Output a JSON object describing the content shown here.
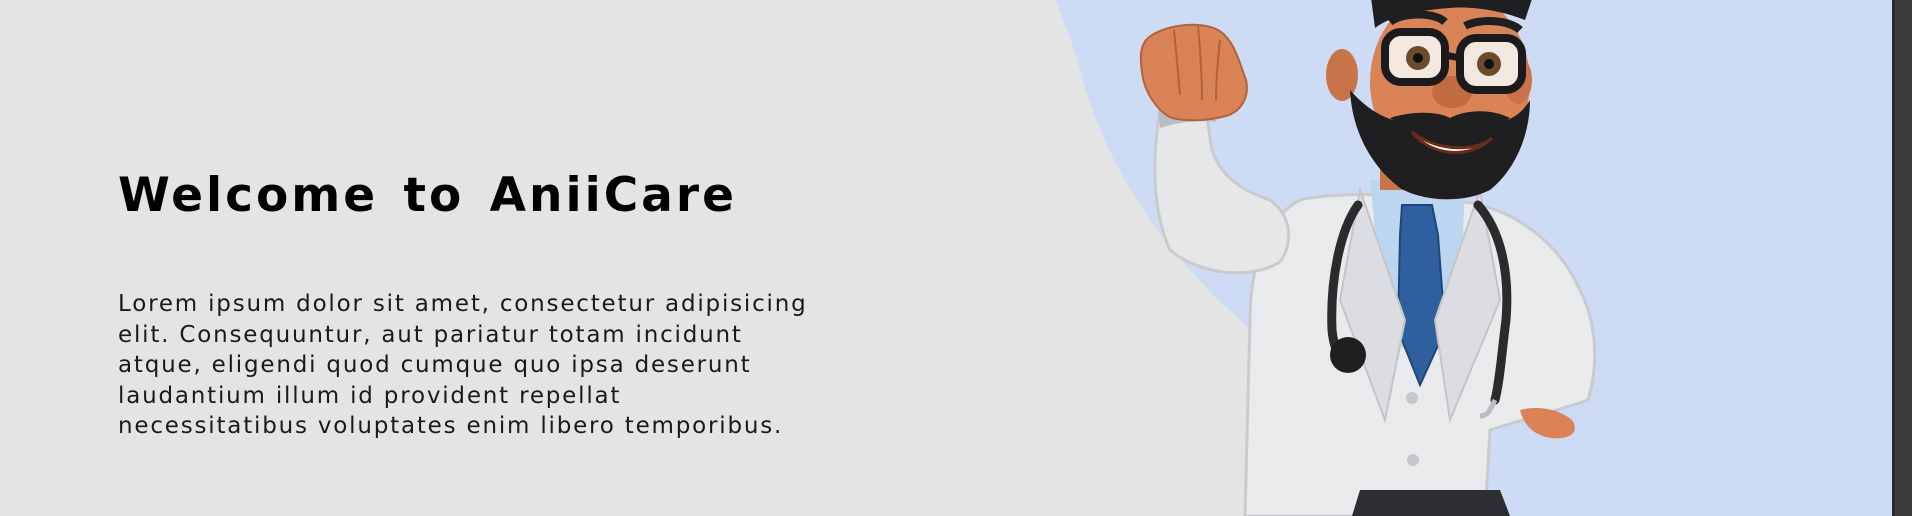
{
  "hero": {
    "title": "Welcome to AniiCare",
    "paragraph_lines": [
      "Lorem ipsum dolor sit amet, consectetur adipisicing",
      "elit. Consequuntur, aut pariatur totam incidunt",
      "atque, eligendi quod cumque quo ipsa deserunt",
      "laudantium illum id provident repellat",
      "necessitatibus voluptates enim libero temporibus."
    ]
  },
  "illustration": {
    "icon": "doctor-cartoon-illustration"
  },
  "colors": {
    "page_background": "#e4e4e4",
    "illustration_background": "#cddcf4",
    "title_text": "#000000",
    "body_text": "#1a1a1a",
    "coat": "#e9eaec",
    "tie": "#2f5f9e",
    "shirt": "#bcd6ef",
    "skin": "#d98356",
    "beard": "#1f1f22",
    "scrollbar": "#3b3b3b"
  }
}
